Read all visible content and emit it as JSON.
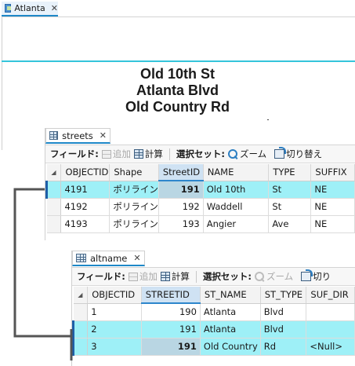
{
  "map": {
    "tab_label": "Atlanta",
    "labels": [
      "Old 10th St",
      "Atlanta Blvd",
      "Old Country Rd"
    ]
  },
  "streets": {
    "tab_label": "streets",
    "toolbar": {
      "field_label": "フィールド:",
      "add_label": "追加",
      "calc_label": "計算",
      "selection_label": "選択セット:",
      "zoom_label": "ズーム",
      "switch_label": "切り替え"
    },
    "columns": [
      "OBJECTID",
      "Shape",
      "StreetID",
      "NAME",
      "TYPE",
      "SUFFIX"
    ],
    "rows": [
      {
        "objectid": "4191",
        "shape": "ポリライン",
        "streetid": "191",
        "name": "Old 10th",
        "type": "St",
        "suffix": "NE",
        "highlighted": true
      },
      {
        "objectid": "4192",
        "shape": "ポリライン",
        "streetid": "192",
        "name": "Waddell",
        "type": "St",
        "suffix": "NE",
        "highlighted": false
      },
      {
        "objectid": "4193",
        "shape": "ポリライン",
        "streetid": "193",
        "name": "Angier",
        "type": "Ave",
        "suffix": "NE",
        "highlighted": false
      }
    ]
  },
  "altname": {
    "tab_label": "altname",
    "toolbar": {
      "field_label": "フィールド:",
      "add_label": "追加",
      "calc_label": "計算",
      "selection_label": "選択セット:",
      "zoom_label": "ズーム",
      "switch_label": "切り"
    },
    "columns": [
      "OBJECTID",
      "STREETID",
      "ST_NAME",
      "ST_TYPE",
      "SUF_DIR"
    ],
    "rows": [
      {
        "objectid": "1",
        "streetid": "190",
        "st_name": "Atlanta",
        "st_type": "Blvd",
        "suf_dir": "",
        "highlighted": false
      },
      {
        "objectid": "2",
        "streetid": "191",
        "st_name": "Atlanta",
        "st_type": "Blvd",
        "suf_dir": "",
        "highlighted": true
      },
      {
        "objectid": "3",
        "streetid": "191",
        "st_name": "Old Country",
        "st_type": "Rd",
        "suf_dir": "<Null>",
        "highlighted": true
      }
    ]
  },
  "colors": {
    "highlight_row": "#9ef0f7",
    "street_line": "#35c5db",
    "tab_accent": "#1e88c8",
    "connector": "#555555"
  }
}
